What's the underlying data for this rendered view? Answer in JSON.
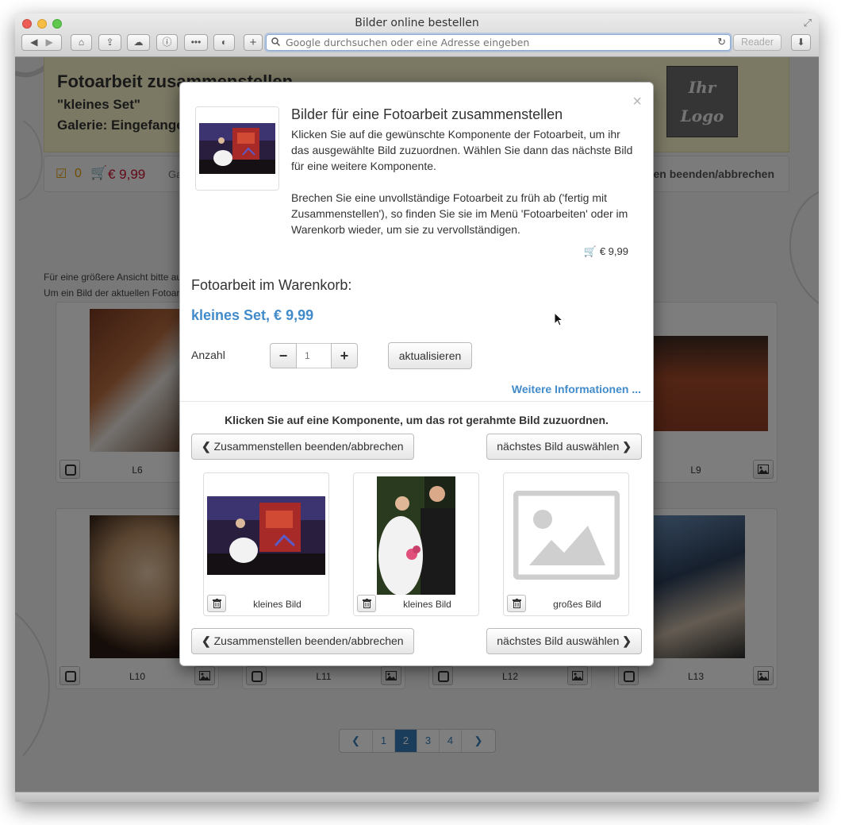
{
  "browser": {
    "title": "Bilder online bestellen",
    "address_placeholder": "Google durchsuchen oder eine Adresse eingeben",
    "reader_label": "Reader",
    "nav_icons": [
      "back-icon",
      "forward-icon",
      "home-icon",
      "share-icon",
      "icloud-icon",
      "info-icon",
      "top-sites-icon",
      "ghostery-icon",
      "add-tab-icon",
      "reload-icon",
      "downloads-icon"
    ]
  },
  "page": {
    "header": {
      "title": "Fotoarbeit zusammenstellen",
      "subtitle": "\"kleines Set\"",
      "gallery": "Galerie: Eingefange",
      "logo_line1": "Ihr",
      "logo_line2": "Logo"
    },
    "bar": {
      "checked_count": "0",
      "price": "€ 9,99",
      "gallery_short": "Ga",
      "end_label": "en beenden/abbrechen"
    },
    "hint1": "Für eine größere Ansicht bitte au",
    "hint2": "Um ein Bild der aktuellen Fotoar",
    "thumbnails": [
      {
        "label": "L6"
      },
      {
        "label": "L9"
      },
      {
        "label": "L10"
      },
      {
        "label": "L11"
      },
      {
        "label": "L12"
      },
      {
        "label": "L13"
      }
    ],
    "pager": {
      "pages": [
        "1",
        "2",
        "3",
        "4"
      ],
      "active": "2"
    }
  },
  "modal": {
    "close": "×",
    "title": "Bilder für eine Fotoarbeit zusammenstellen",
    "text1": "Klicken Sie auf die gewünschte Komponente der Fotoarbeit, um ihr das ausgewählte Bild zuzuordnen. Wählen Sie dann das nächste Bild für eine weitere Komponente.",
    "text2": "Brechen Sie eine unvollständige Fotoarbeit zu früh ab ('fertig mit Zusammenstellen'), so finden Sie sie im Menü 'Fotoarbeiten' oder im Warenkorb wieder, um sie zu vervollständigen.",
    "cart_price": "€ 9,99",
    "cart_heading": "Fotoarbeit im Warenkorb:",
    "set_name": "kleines Set, € 9,99",
    "quantity_label": "Anzahl",
    "quantity_value": "1",
    "minus": "−",
    "plus": "+",
    "update_label": "aktualisieren",
    "more_info": "Weitere Informationen ...",
    "instruction": "Klicken Sie auf eine Komponente, um das rot gerahmte Bild zuzuordnen.",
    "end_button": "Zusammenstellen beenden/abbrechen",
    "next_button": "nächstes Bild auswählen",
    "components": [
      {
        "label": "kleines Bild"
      },
      {
        "label": "kleines Bild"
      },
      {
        "label": "großes Bild"
      }
    ]
  },
  "colors": {
    "accent_blue": "#428bca",
    "cart_red": "#c8102e",
    "check_orange": "#e49a00",
    "header_bg": "#f7f3c8"
  }
}
